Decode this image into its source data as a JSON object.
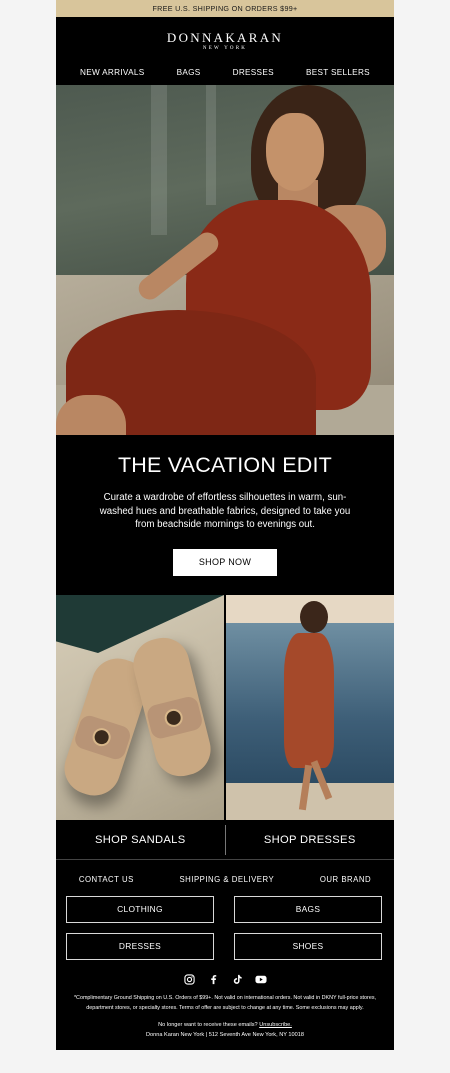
{
  "topbar": {
    "text": "FREE U.S. SHIPPING ON ORDERS $99+"
  },
  "logo": {
    "brand": "DONNAKARAN",
    "sub": "NEW YORK"
  },
  "nav": [
    "NEW ARRIVALS",
    "BAGS",
    "DRESSES",
    "BEST SELLERS"
  ],
  "edit": {
    "title": "THE VACATION EDIT",
    "body": "Curate a wardrobe of effortless silhouettes in warm, sun-washed hues and breathable fabrics, designed to take you from beachside mornings to evenings out.",
    "cta": "SHOP NOW"
  },
  "shop": {
    "left": "SHOP SANDALS",
    "right": "SHOP DRESSES"
  },
  "links": [
    "CONTACT US",
    "SHIPPING & DELIVERY",
    "OUR BRAND"
  ],
  "categories": [
    "CLOTHING",
    "BAGS",
    "DRESSES",
    "SHOES"
  ],
  "social": [
    "instagram-icon",
    "facebook-icon",
    "tiktok-icon",
    "youtube-icon"
  ],
  "legal": "*Complimentary Ground Shipping on U.S. Orders of $99+. Not valid on international orders. Not valid in DKNY full-price stores, department stores, or specialty stores. Terms of offer are subject to change at any time. Some exclusions may apply.",
  "unsub": {
    "prefix": "No longer want to receive these emails?",
    "link": "Unsubscribe."
  },
  "address": "Donna Karan New York | 512 Seventh Ave New York, NY 10018",
  "colors": {
    "topbar": "#d8c59b",
    "background": "#000000",
    "page": "#f4f4f4"
  }
}
